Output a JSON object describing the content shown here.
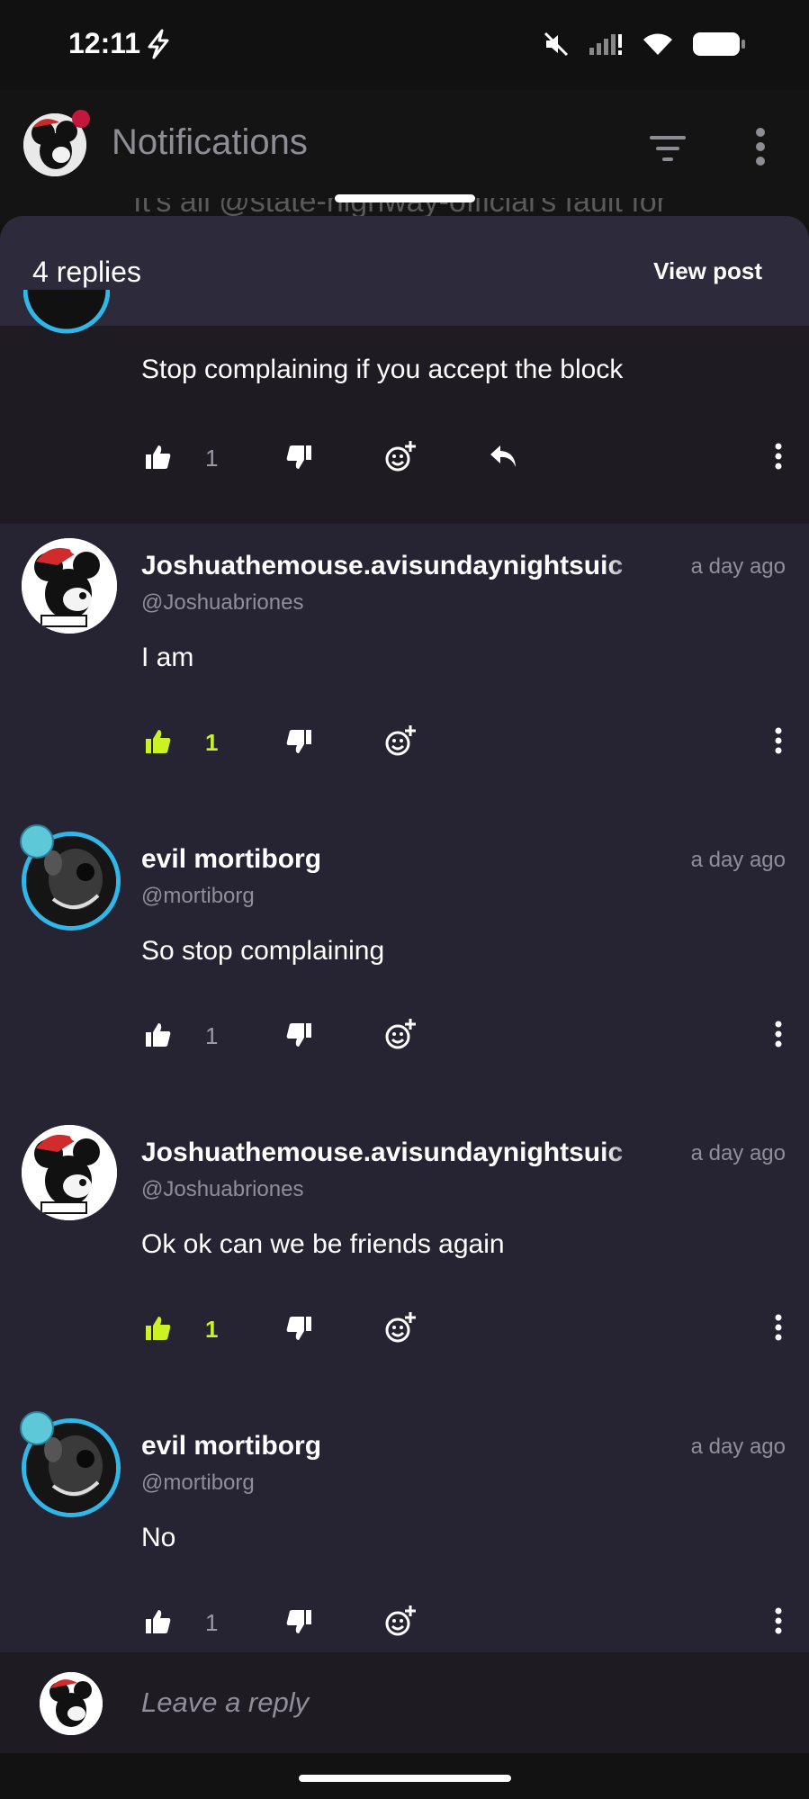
{
  "status_bar": {
    "time": "12:11"
  },
  "header": {
    "title": "Notifications",
    "peek_text": "It's all @state-highway-official's fault for"
  },
  "sheet": {
    "replies_count": "4 replies",
    "view_post": "View post"
  },
  "parent_comment": {
    "text": "Stop complaining if you accept the block",
    "likes": "1"
  },
  "replies": [
    {
      "author": "Joshuathemouse.avisundaynightsuic",
      "handle": "@Joshuabriones",
      "time": "a day ago",
      "text": "I am",
      "likes": "1",
      "liked": true
    },
    {
      "author": "evil mortiborg",
      "handle": "@mortiborg",
      "time": "a day ago",
      "text": "So stop complaining",
      "likes": "1",
      "liked": false
    },
    {
      "author": "Joshuathemouse.avisundaynightsuic",
      "handle": "@Joshuabriones",
      "time": "a day ago",
      "text": "Ok ok can we be friends again",
      "likes": "1",
      "liked": true
    },
    {
      "author": "evil mortiborg",
      "handle": "@mortiborg",
      "time": "a day ago",
      "text": "No",
      "likes": "1",
      "liked": false
    }
  ],
  "composer": {
    "placeholder": "Leave a reply"
  },
  "colors": {
    "liked": "#cdf223",
    "sheet_bg": "#262433",
    "ring": "#31b6e8"
  }
}
